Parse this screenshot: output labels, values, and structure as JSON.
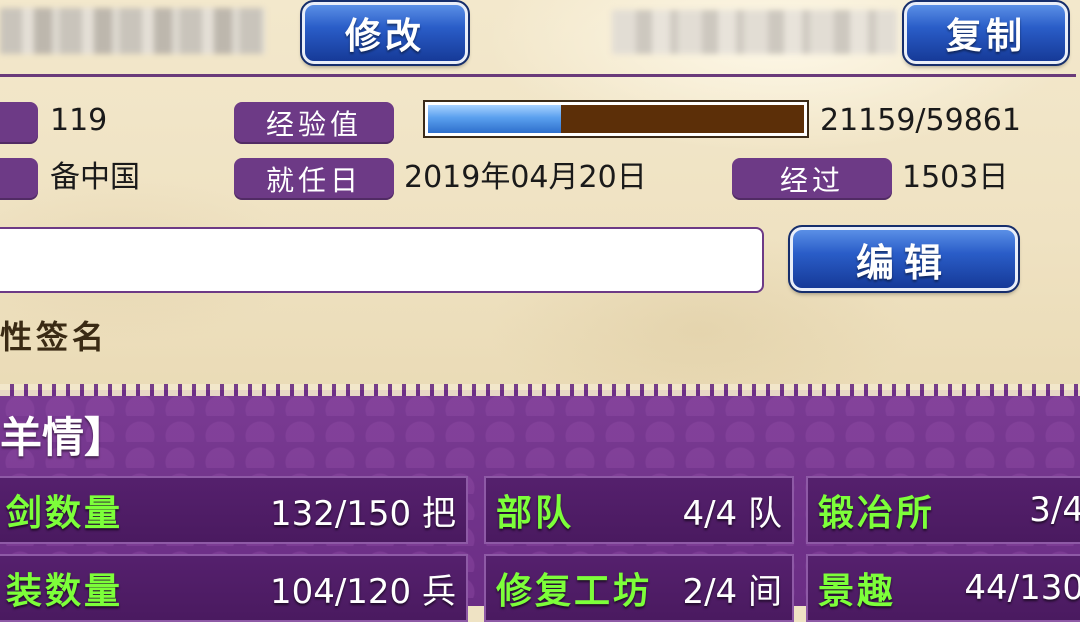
{
  "header": {
    "modify_label": "修改",
    "copy_label": "复制"
  },
  "profile": {
    "level_value": "119",
    "exp_label": "经验值",
    "exp_value": "21159/59861",
    "exp_progress": 0.353,
    "server_value": "备中国",
    "start_label": "就任日",
    "start_value": "2019年04月20日",
    "elapsed_label": "经过",
    "elapsed_value": "1503日"
  },
  "signature": {
    "input_value": "",
    "edit_label": "编辑",
    "label": "性签名"
  },
  "details": {
    "title": "羊情】",
    "stats": [
      {
        "name": "剑数量",
        "value": "132/150 把"
      },
      {
        "name": "部队",
        "value": "4/4 队"
      },
      {
        "name": "锻冶所",
        "value": "3/4"
      },
      {
        "name": "装数量",
        "value": "104/120 兵"
      },
      {
        "name": "修复工坊",
        "value": "2/4 间"
      },
      {
        "name": "景趣",
        "value": "44/130"
      }
    ]
  },
  "colors": {
    "accent_purple": "#6d3a86",
    "button_blue": "#2a5dc8",
    "stat_green": "#7dff3a",
    "progress_bar_track": "#5c2f08",
    "progress_bar_fill": "#5aa0ee"
  }
}
